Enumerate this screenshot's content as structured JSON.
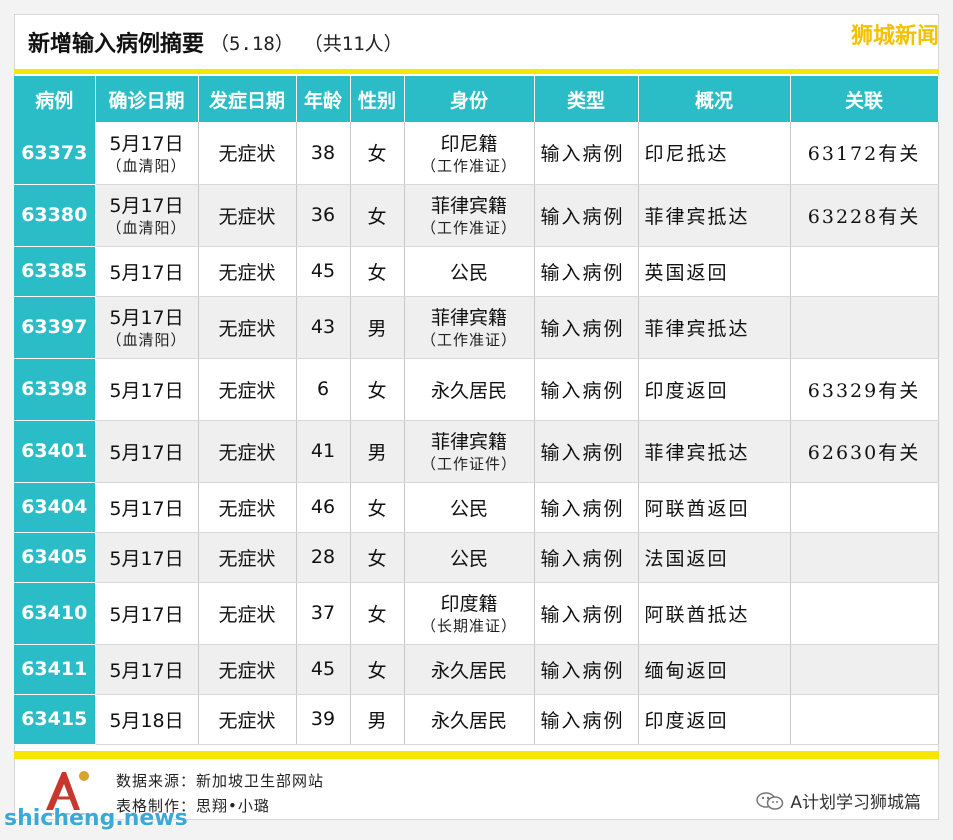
{
  "header": {
    "title": "新增输入病例摘要",
    "date": "（5.18）",
    "count": "（共11人）",
    "brand": "狮城新闻"
  },
  "columns": [
    "病例",
    "确诊日期",
    "发症日期",
    "年龄",
    "性别",
    "身份",
    "类型",
    "概况",
    "关联"
  ],
  "rows": [
    {
      "id": "63373",
      "confirm": "5月17日",
      "confirm_note": "（血清阳）",
      "onset": "无症状",
      "age": "38",
      "sex": "女",
      "identity": "印尼籍",
      "identity_note": "（工作准证）",
      "type": "输入病例",
      "summary": "印尼抵达",
      "link": "63172有关"
    },
    {
      "id": "63380",
      "confirm": "5月17日",
      "confirm_note": "（血清阳）",
      "onset": "无症状",
      "age": "36",
      "sex": "女",
      "identity": "菲律宾籍",
      "identity_note": "（工作准证）",
      "type": "输入病例",
      "summary": "菲律宾抵达",
      "link": "63228有关"
    },
    {
      "id": "63385",
      "confirm": "5月17日",
      "confirm_note": "",
      "onset": "无症状",
      "age": "45",
      "sex": "女",
      "identity": "公民",
      "identity_note": "",
      "type": "输入病例",
      "summary": "英国返回",
      "link": ""
    },
    {
      "id": "63397",
      "confirm": "5月17日",
      "confirm_note": "（血清阳）",
      "onset": "无症状",
      "age": "43",
      "sex": "男",
      "identity": "菲律宾籍",
      "identity_note": "（工作准证）",
      "type": "输入病例",
      "summary": "菲律宾抵达",
      "link": ""
    },
    {
      "id": "63398",
      "confirm": "5月17日",
      "confirm_note": "",
      "onset": "无症状",
      "age": "6",
      "sex": "女",
      "identity": "永久居民",
      "identity_note": "",
      "type": "输入病例",
      "summary": "印度返回",
      "link": "63329有关"
    },
    {
      "id": "63401",
      "confirm": "5月17日",
      "confirm_note": "",
      "onset": "无症状",
      "age": "41",
      "sex": "男",
      "identity": "菲律宾籍",
      "identity_note": "（工作证件）",
      "type": "输入病例",
      "summary": "菲律宾抵达",
      "link": "62630有关"
    },
    {
      "id": "63404",
      "confirm": "5月17日",
      "confirm_note": "",
      "onset": "无症状",
      "age": "46",
      "sex": "女",
      "identity": "公民",
      "identity_note": "",
      "type": "输入病例",
      "summary": "阿联酋返回",
      "link": ""
    },
    {
      "id": "63405",
      "confirm": "5月17日",
      "confirm_note": "",
      "onset": "无症状",
      "age": "28",
      "sex": "女",
      "identity": "公民",
      "identity_note": "",
      "type": "输入病例",
      "summary": "法国返回",
      "link": ""
    },
    {
      "id": "63410",
      "confirm": "5月17日",
      "confirm_note": "",
      "onset": "无症状",
      "age": "37",
      "sex": "女",
      "identity": "印度籍",
      "identity_note": "（长期准证）",
      "type": "输入病例",
      "summary": "阿联酋抵达",
      "link": ""
    },
    {
      "id": "63411",
      "confirm": "5月17日",
      "confirm_note": "",
      "onset": "无症状",
      "age": "45",
      "sex": "女",
      "identity": "永久居民",
      "identity_note": "",
      "type": "输入病例",
      "summary": "缅甸返回",
      "link": ""
    },
    {
      "id": "63415",
      "confirm": "5月18日",
      "confirm_note": "",
      "onset": "无症状",
      "age": "39",
      "sex": "男",
      "identity": "永久居民",
      "identity_note": "",
      "type": "输入病例",
      "summary": "印度返回",
      "link": ""
    }
  ],
  "footer": {
    "source": "数据来源：新加坡卫生部网站",
    "maker": "表格制作：思翔•小璐",
    "wechat": "A计划学习狮城篇",
    "watermark": "shicheng.news"
  },
  "colors": {
    "accent": "#2bbdc7",
    "highlight": "#f7e600",
    "brand": "#f2c200"
  }
}
